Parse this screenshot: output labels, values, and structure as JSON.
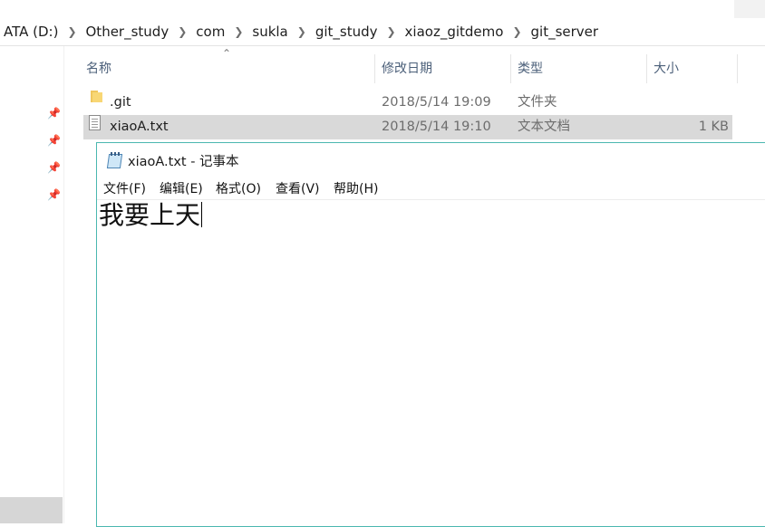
{
  "explorer": {
    "breadcrumb": [
      "ATA (D:)",
      "Other_study",
      "com",
      "sukla",
      "git_study",
      "xiaoz_gitdemo",
      "git_server"
    ],
    "columns": {
      "name": "名称",
      "date": "修改日期",
      "type": "类型",
      "size": "大小"
    },
    "files": [
      {
        "name": ".git",
        "date": "2018/5/14 19:09",
        "type": "文件夹",
        "size": "",
        "icon": "folder-icon"
      },
      {
        "name": "xiaoA.txt",
        "date": "2018/5/14 19:10",
        "type": "文本文档",
        "size": "1 KB",
        "icon": "text-file-icon",
        "selected": true
      }
    ]
  },
  "notepad": {
    "title": "xiaoA.txt - 记事本",
    "menu": [
      "文件(F)",
      "编辑(E)",
      "格式(O)",
      "查看(V)",
      "帮助(H)"
    ],
    "content": "我要上天"
  },
  "colors": {
    "accent_border": "#4bb7b0",
    "selection": "#d9d9d9",
    "header_text": "#4c607a"
  }
}
